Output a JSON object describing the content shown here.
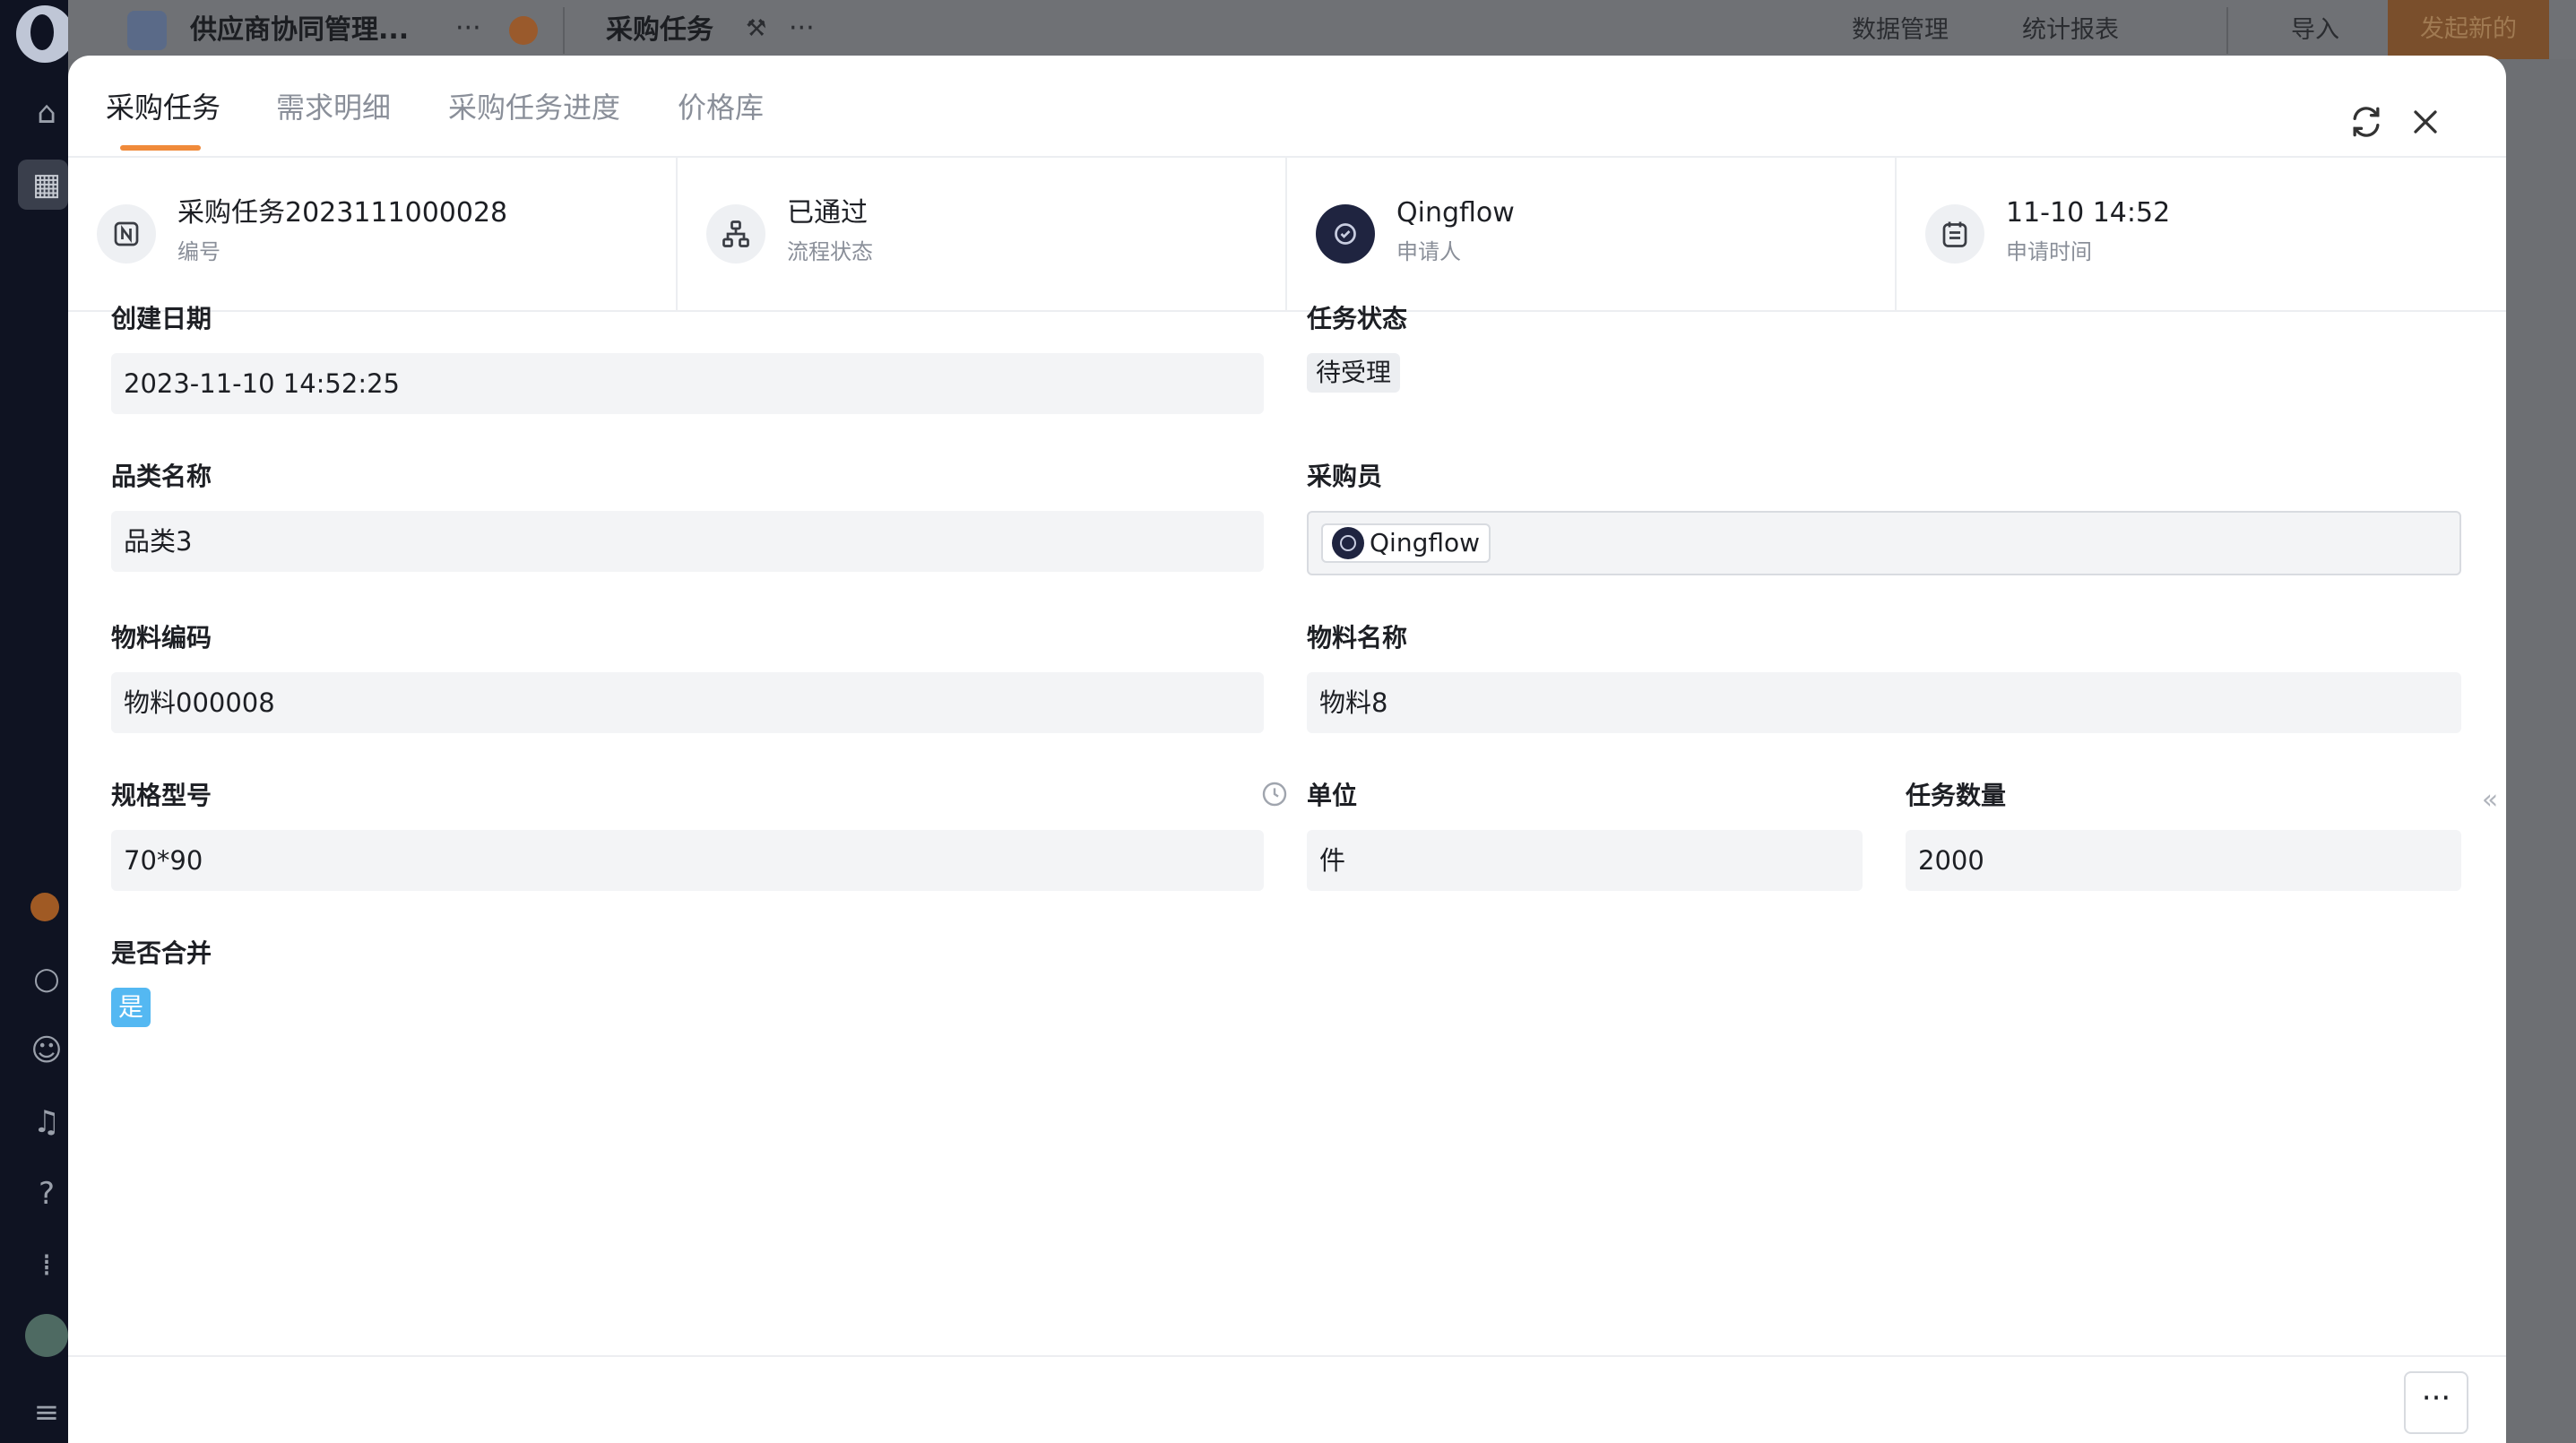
{
  "background_app": {
    "app_name": "供应商协同管理...",
    "form_name": "采购任务",
    "nav": [
      "数据管理",
      "统计报表",
      "导入",
      "发起新的"
    ],
    "more": "···"
  },
  "tabs": [
    {
      "label": "采购任务",
      "active": true
    },
    {
      "label": "需求明细",
      "active": false
    },
    {
      "label": "采购任务进度",
      "active": false
    },
    {
      "label": "价格库",
      "active": false
    }
  ],
  "meta": [
    {
      "icon": "number-icon",
      "value": "采购任务2023111000028",
      "label": "编号"
    },
    {
      "icon": "workflow-icon",
      "value": "已通过",
      "label": "流程状态"
    },
    {
      "icon": "user-avatar",
      "value": "Qingflow",
      "label": "申请人"
    },
    {
      "icon": "calendar-icon",
      "value": "11-10 14:52",
      "label": "申请时间"
    }
  ],
  "fields": {
    "create_date": {
      "label": "创建日期",
      "value": "2023-11-10 14:52:25"
    },
    "task_status": {
      "label": "任务状态",
      "value": "待受理"
    },
    "category_name": {
      "label": "品类名称",
      "value": "品类3"
    },
    "buyer": {
      "label": "采购员",
      "value": "Qingflow"
    },
    "material_code": {
      "label": "物料编码",
      "value": "物料000008"
    },
    "material_name": {
      "label": "物料名称",
      "value": "物料8"
    },
    "spec_model": {
      "label": "规格型号",
      "value": "70*90"
    },
    "unit": {
      "label": "单位",
      "value": "件"
    },
    "task_quantity": {
      "label": "任务数量",
      "value": "2000"
    },
    "is_merged": {
      "label": "是否合并",
      "value": "是"
    }
  },
  "footer": {
    "more_label": "···"
  },
  "colors": {
    "accent": "#f08a3a",
    "tag_blue": "#54b8f2",
    "field_bg": "#f3f4f6"
  }
}
